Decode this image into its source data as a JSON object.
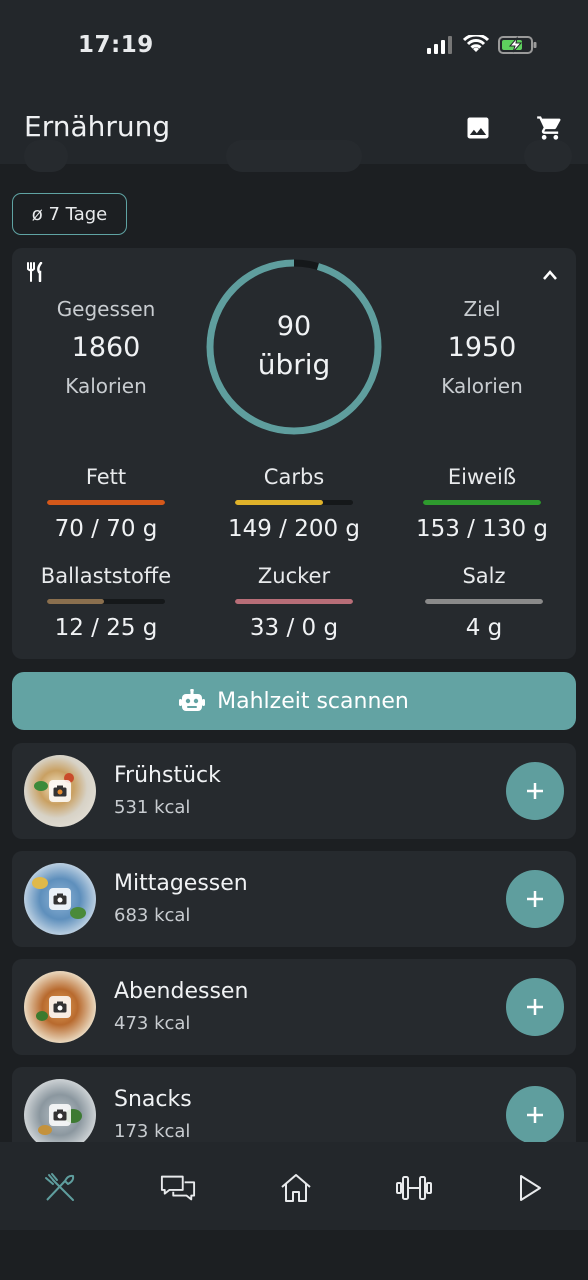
{
  "status_bar": {
    "time": "17:19"
  },
  "header": {
    "title": "Ernährung",
    "icons": [
      "image-icon",
      "cart-icon"
    ]
  },
  "filter_chip": {
    "label": "ø 7 Tage"
  },
  "summary": {
    "eaten": {
      "label": "Gegessen",
      "value": "1860",
      "unit": "Kalorien"
    },
    "remaining": {
      "value": "90",
      "label": "übrig",
      "progress": 0.954
    },
    "goal": {
      "label": "Ziel",
      "value": "1950",
      "unit": "Kalorien"
    },
    "macros": [
      {
        "label": "Fett",
        "value": "70 / 70 g",
        "color": "#d4581a",
        "progress": 1.0
      },
      {
        "label": "Carbs",
        "value": "149 / 200 g",
        "color": "#e0b22a",
        "progress": 0.745
      },
      {
        "label": "Eiweiß",
        "value": "153 / 130 g",
        "color": "#2e9a2e",
        "progress": 1.0
      },
      {
        "label": "Ballaststoffe",
        "value": "12 / 25 g",
        "color": "#8a6f4e",
        "progress": 0.48
      },
      {
        "label": "Zucker",
        "value": "33 / 0 g",
        "color": "#b86e78",
        "progress": 1.0
      },
      {
        "label": "Salz",
        "value": "4 g",
        "color": "#8a8a8a",
        "progress": 1.0
      }
    ]
  },
  "scan_button": {
    "label": "Mahlzeit scannen"
  },
  "meals": [
    {
      "name": "Frühstück",
      "kcal": "531 kcal"
    },
    {
      "name": "Mittagessen",
      "kcal": "683 kcal"
    },
    {
      "name": "Abendessen",
      "kcal": "473 kcal"
    },
    {
      "name": "Snacks",
      "kcal": "173 kcal"
    }
  ],
  "bottom_nav": {
    "items": [
      "nutrition-icon",
      "chat-icon",
      "home-icon",
      "workout-icon",
      "play-icon"
    ],
    "active": "nutrition-icon"
  },
  "colors": {
    "accent": "#5f9e9e",
    "background": "#1c1f22",
    "card": "#262a2e"
  }
}
